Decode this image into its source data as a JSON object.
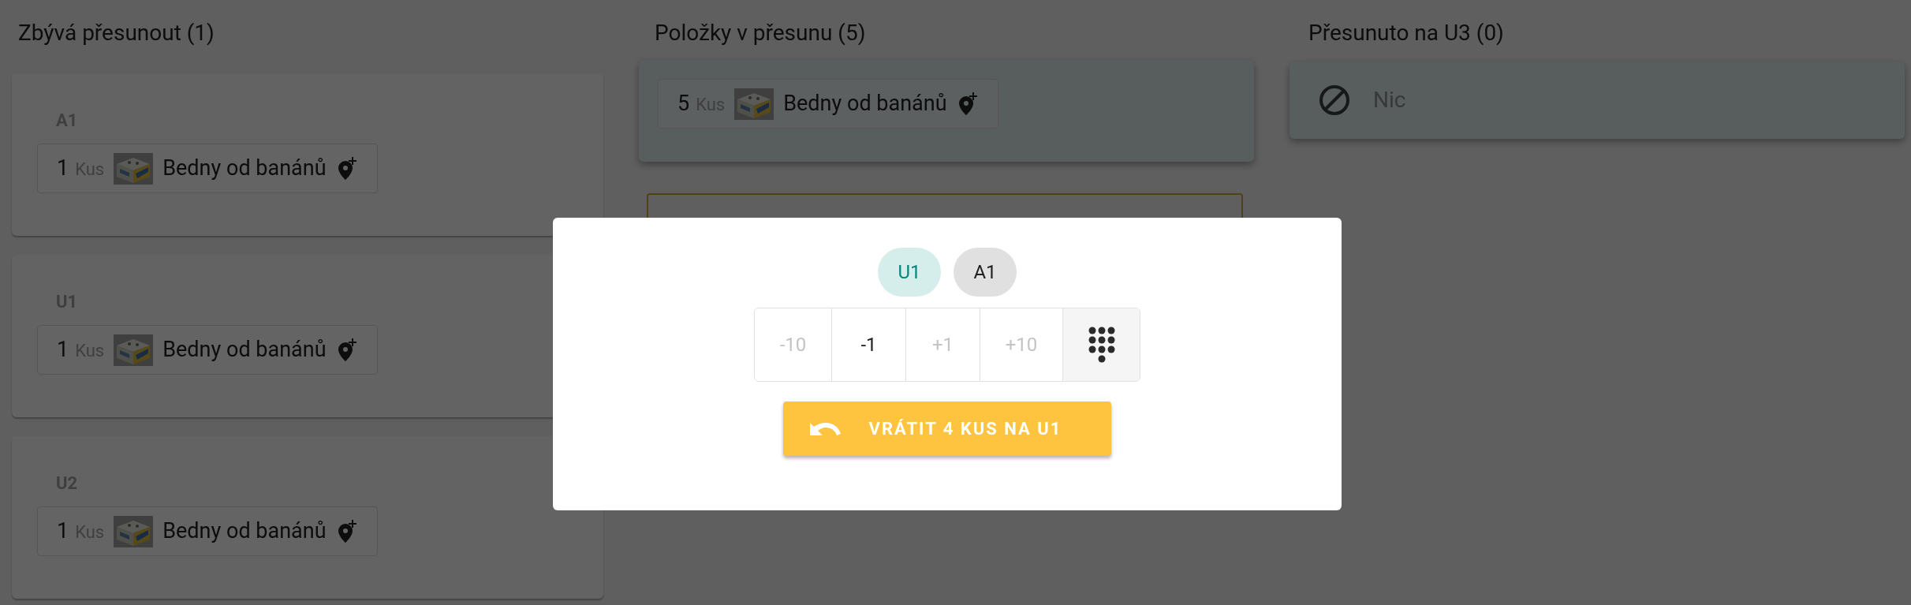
{
  "remaining": {
    "title": "Zbývá přesunout (1)",
    "groups": [
      {
        "label": "A1",
        "items": [
          {
            "qty": "1",
            "unit": "Kus",
            "name": "Bedny od banánů"
          }
        ]
      },
      {
        "label": "U1",
        "items": [
          {
            "qty": "1",
            "unit": "Kus",
            "name": "Bedny od banánů"
          }
        ]
      },
      {
        "label": "U2",
        "items": [
          {
            "qty": "1",
            "unit": "Kus",
            "name": "Bedny od banánů"
          }
        ]
      }
    ]
  },
  "in_transit": {
    "title": "Položky v přesunu (5)",
    "items": [
      {
        "qty": "5",
        "unit": "Kus",
        "name": "Bedny od banánů"
      }
    ]
  },
  "moved": {
    "title": "Přesunuto na U3 (0)",
    "empty": "Nic"
  },
  "dialog": {
    "locations": [
      {
        "label": "U1",
        "selected": true
      },
      {
        "label": "A1",
        "selected": false
      }
    ],
    "steps": [
      {
        "label": "-10",
        "disabled": true
      },
      {
        "label": "-1",
        "disabled": false
      },
      {
        "label": "+1",
        "disabled": true
      },
      {
        "label": "+10",
        "disabled": true
      }
    ],
    "confirm": "VRÁTIT 4 KUS NA U1"
  }
}
